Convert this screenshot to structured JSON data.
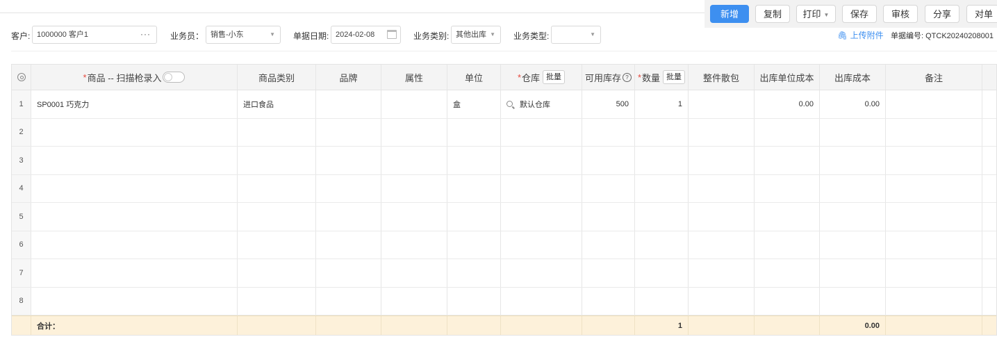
{
  "toolbar": {
    "buttons": [
      "新增",
      "复制",
      "打印",
      "保存",
      "审核",
      "分享",
      "对单"
    ]
  },
  "filters": {
    "customer_label": "客户:",
    "customer_value": "1000000 客户1",
    "salesman_label": "业务员：",
    "salesman_value": "销售-小东",
    "date_label": "单据日期:",
    "date_value": "2024-02-08",
    "biz_category_label": "业务类别:",
    "biz_category_value": "其他出库",
    "biz_type_label": "业务类型:",
    "biz_type_value": "",
    "attach_label": "上传附件",
    "doc_no": "单据编号: QTCK20240208001"
  },
  "table": {
    "headers": {
      "product": "商品 -- 扫描枪录入",
      "category": "商品类别",
      "brand": "品牌",
      "attr": "属性",
      "unit": "单位",
      "warehouse": "仓库",
      "batch": "批量",
      "stock": "可用库存",
      "qty": "数量",
      "pack": "整件散包",
      "unit_cost": "出库单位成本",
      "cost": "出库成本",
      "remark": "备注"
    },
    "rows": [
      {
        "no": "1",
        "product": "SP0001 巧克力",
        "category": "进口食品",
        "unit": "盒",
        "warehouse": "默认仓库",
        "stock": "500",
        "qty": "1",
        "unit_cost": "0.00",
        "cost": "0.00"
      },
      {
        "no": "2"
      },
      {
        "no": "3"
      },
      {
        "no": "4"
      },
      {
        "no": "5"
      },
      {
        "no": "6"
      },
      {
        "no": "7"
      },
      {
        "no": "8"
      }
    ],
    "footer": {
      "label": "合计：",
      "qty": "1",
      "cost": "0.00"
    }
  }
}
